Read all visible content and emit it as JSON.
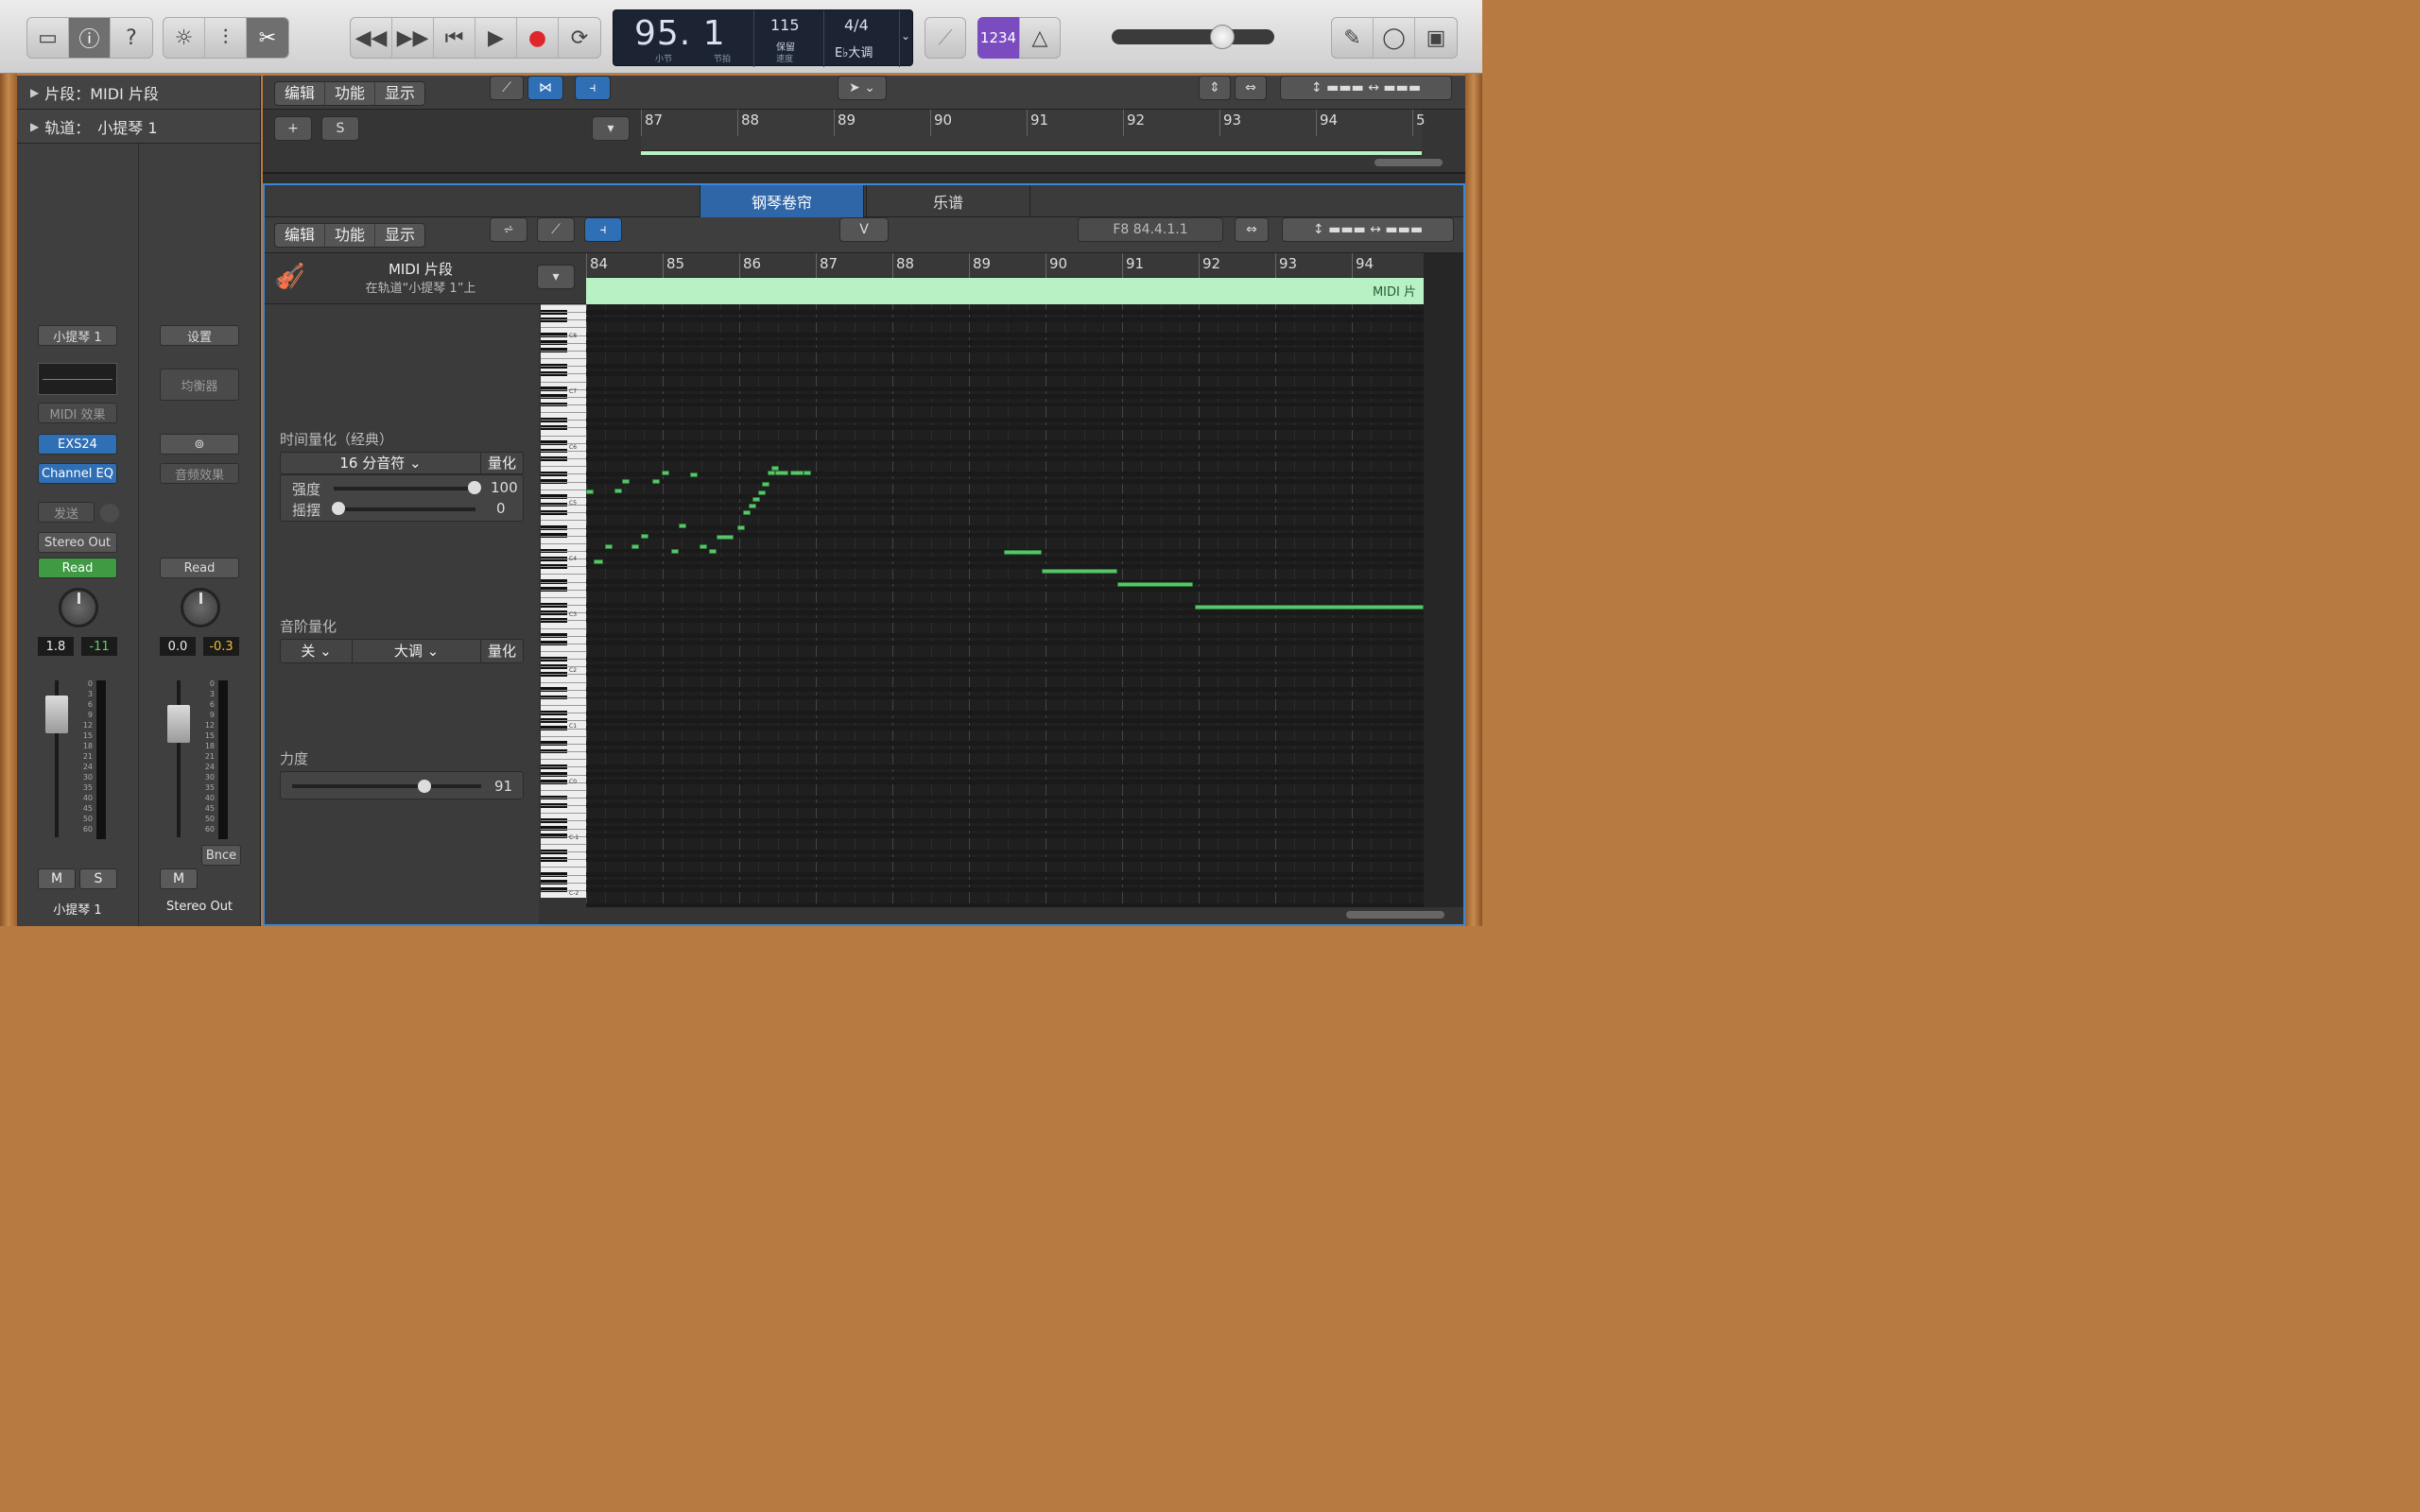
{
  "transport": {
    "position": "95. 1",
    "pos_bar_label": "小节",
    "pos_beat_label": "节拍",
    "tempo": "115",
    "tempo_mode": "保留",
    "tempo_label": "速度",
    "signature": "4/4",
    "key": "E♭大调",
    "count_in": "1234"
  },
  "inspector": {
    "region_row": "片段：MIDI 片段",
    "track_row_label": "轨道：",
    "track_row_value": "小提琴 1",
    "strip1": {
      "name_btn": "小提琴 1",
      "midi_fx": "MIDI 效果",
      "instrument": "EXS24",
      "audio_fx": "Channel EQ",
      "send": "发送",
      "output": "Stereo Out",
      "automation": "Read",
      "pan_value": "1.8",
      "level_value": "-11",
      "m": "M",
      "s": "S",
      "footer": "小提琴 1"
    },
    "strip2": {
      "settings": "设置",
      "eq": "均衡器",
      "audio_fx": "音频效果",
      "automation": "Read",
      "pan_value": "0.0",
      "level_value": "-0.3",
      "bounce": "Bnce",
      "m": "M",
      "footer": "Stereo Out"
    },
    "meter_scale": [
      "0",
      "3",
      "6",
      "9",
      "12",
      "15",
      "18",
      "21",
      "24",
      "30",
      "35",
      "40",
      "45",
      "50",
      "60"
    ]
  },
  "tracks_toolbar": {
    "edit": "编辑",
    "functions": "功能",
    "view": "显示",
    "add": "+",
    "s": "S"
  },
  "track_ruler": [
    "87",
    "88",
    "89",
    "90",
    "91",
    "92",
    "93",
    "94",
    "5"
  ],
  "editor": {
    "tab_piano_roll": "钢琴卷帘",
    "tab_score": "乐谱",
    "edit": "编辑",
    "functions": "功能",
    "view": "显示",
    "velocity_tool": "V",
    "info": "F8   84.4.1.1",
    "region_title": "MIDI 片段",
    "region_sub": "在轨道“小提琴 1”上",
    "region_label": "MIDI 片",
    "ruler": [
      "84",
      "85",
      "86",
      "87",
      "88",
      "89",
      "90",
      "91",
      "92",
      "93",
      "94",
      "5"
    ],
    "time_quant_label": "时间量化（经典）",
    "time_quant_value": "16 分音符",
    "quantize": "量化",
    "strength_label": "强度",
    "strength_value": "100",
    "swing_label": "摇摆",
    "swing_value": "0",
    "scale_quant_label": "音阶量化",
    "scale_off": "关",
    "scale_mode": "大调",
    "velocity_label": "力度",
    "velocity_value": "91",
    "octave_labels": [
      "C8",
      "C7",
      "C6",
      "C5",
      "C4",
      "C3",
      "C2",
      "C1",
      "C0",
      "C-1",
      "C-2"
    ]
  },
  "colors": {
    "accent_blue": "#2f6fb6",
    "note_green": "#58c56a",
    "region_green": "#b8f2c4",
    "purple": "#7a4cc0"
  }
}
